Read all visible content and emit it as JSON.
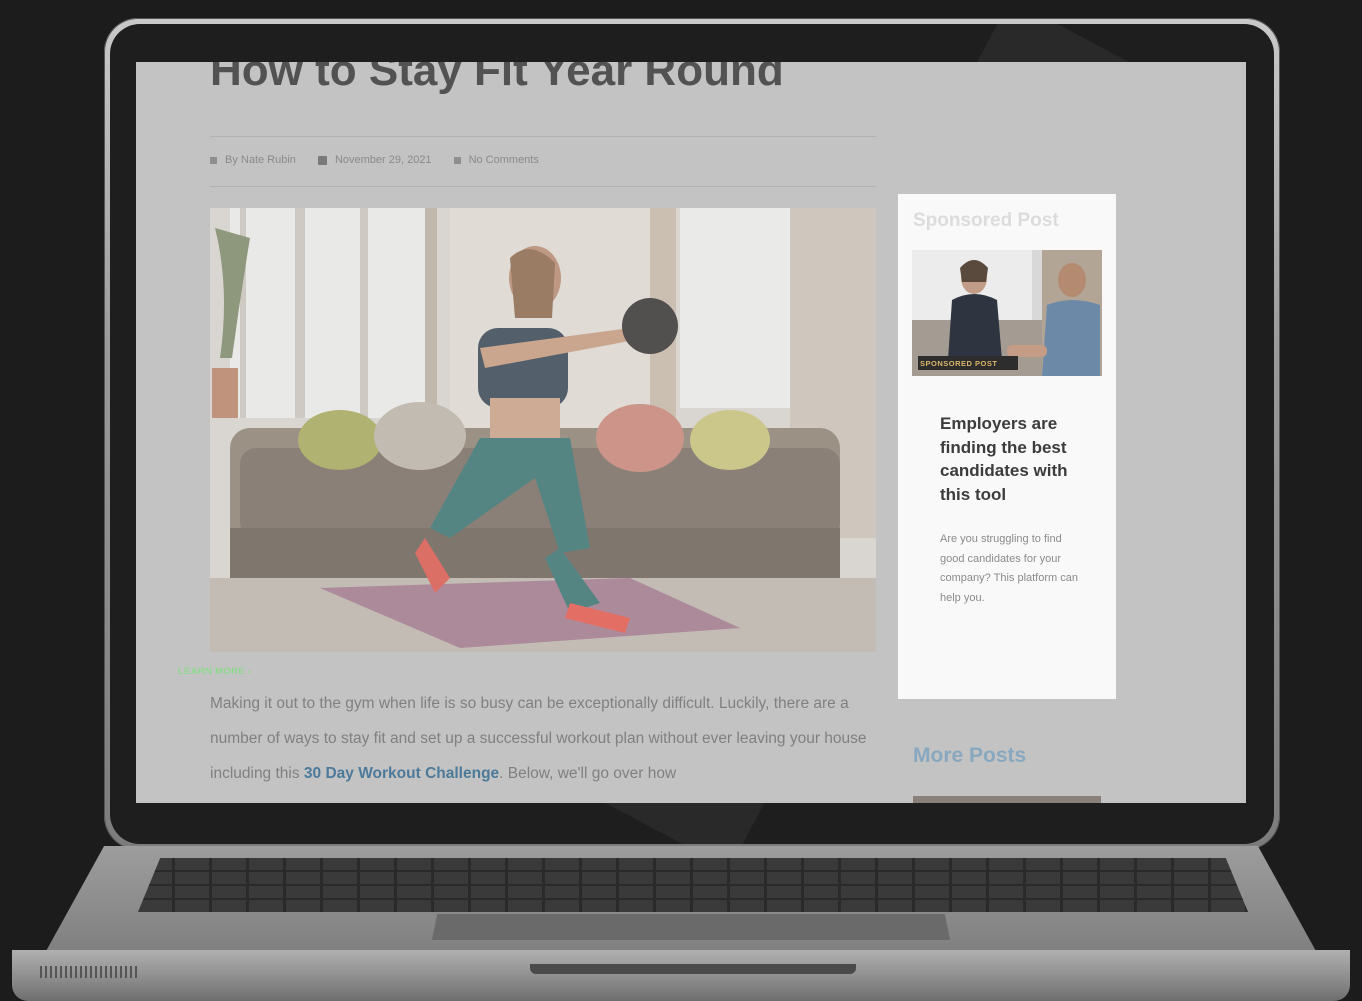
{
  "article": {
    "title": "How to Stay Fit Year Round",
    "meta": {
      "author": "By Nate Rubin",
      "date": "November 29, 2021",
      "comments": "No Comments"
    },
    "hero_image": "woman-lunge-medicine-ball-living-room",
    "body_before_link": "Making it out to the gym when life is so busy can be exceptionally difficult. Luckily, there are a number of ways to stay fit and set up a successful workout plan without ever leaving your house including this ",
    "body_link": "30 Day Workout Challenge",
    "body_after_link": ". Below, we'll go over how"
  },
  "sidebar": {
    "sponsored": {
      "heading": "Sponsored Post",
      "image_badge": "SPONSORED POST",
      "title": "Employers are finding the best candidates with this tool",
      "description": "Are you struggling to find good candidates for your company? This platform can help you.",
      "cta": "LEARN MORE ›"
    },
    "more_posts_heading": "More Posts"
  },
  "colors": {
    "link": "#4d7a9a",
    "cta": "#8fd98f",
    "more_posts": "#88a8c0"
  }
}
